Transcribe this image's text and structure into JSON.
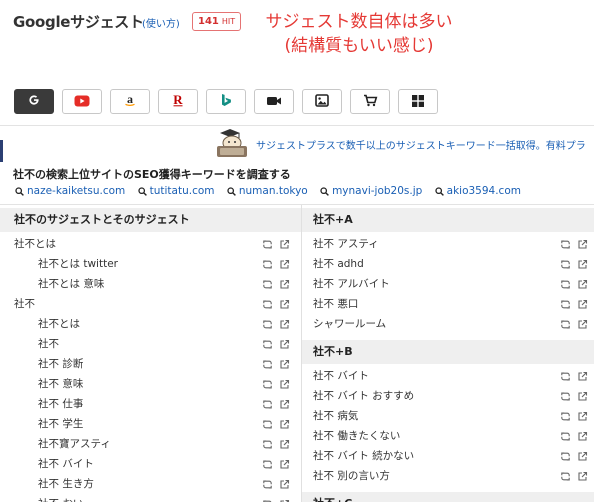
{
  "header": {
    "title": "Googleサジェスト",
    "howto": "(使い方)",
    "hit_count": "141",
    "hit_unit": "HIT",
    "annotation_line1": "サジェスト数自体は多い",
    "annotation_line2": "(結構質もいい感じ)"
  },
  "engines": [
    "google",
    "youtube",
    "amazon",
    "rakuten",
    "bing",
    "video",
    "image",
    "shopping",
    "apps"
  ],
  "promo": {
    "text": "サジェストプラスで数千以上のサジェストキーワード一括取得。有料プラ"
  },
  "seo": {
    "title": "社不の検索上位サイトのSEO獲得キーワードを調査する",
    "links": [
      "naze-kaiketsu.com",
      "tutitatu.com",
      "numan.tokyo",
      "mynavi-job20s.jp",
      "akio3594.com"
    ]
  },
  "left_panel": {
    "heading": "社不のサジェストとそのサジェスト",
    "rows": [
      {
        "text": "社不とは",
        "level": 0
      },
      {
        "text": "社不とは twitter",
        "level": 1
      },
      {
        "text": "社不とは 意味",
        "level": 1
      },
      {
        "text": "社不",
        "level": 0
      },
      {
        "text": "社不とは",
        "level": 1
      },
      {
        "text": "社不",
        "level": 1
      },
      {
        "text": "社不 診断",
        "level": 1
      },
      {
        "text": "社不 意味",
        "level": 1
      },
      {
        "text": "社不 仕事",
        "level": 1
      },
      {
        "text": "社不 学生",
        "level": 1
      },
      {
        "text": "社不寶アスティ",
        "level": 1
      },
      {
        "text": "社不 バイト",
        "level": 1
      },
      {
        "text": "社不 生き方",
        "level": 1
      },
      {
        "text": "社不 おい",
        "level": 1
      }
    ]
  },
  "right_panel": {
    "groups": [
      {
        "heading": "社不+A",
        "rows": [
          "社不 アスティ",
          "社不 adhd",
          "社不 アルバイト",
          "社不 悪口",
          "シャワールーム"
        ]
      },
      {
        "heading": "社不+B",
        "rows": [
          "社不 バイト",
          "社不 バイト おすすめ",
          "社不 病気",
          "社不 働きたくない",
          "社不 バイト 続かない",
          "社不 別の言い方"
        ]
      },
      {
        "heading": "社不+C",
        "rows": []
      }
    ]
  },
  "colors": {
    "accent_red": "#e53935",
    "link_blue": "#1a5fb4",
    "active_engine": "#3a3a3a"
  }
}
